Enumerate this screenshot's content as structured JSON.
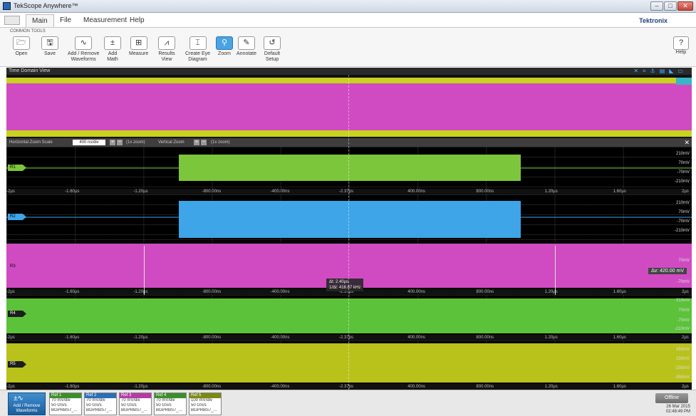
{
  "window": {
    "title": "TekScope Anywhere™"
  },
  "menu": {
    "tabs": [
      "Main",
      "File",
      "Measurement",
      "Help"
    ],
    "brand": "Tektronix"
  },
  "ribbon": {
    "group_label": "COMMON TOOLS",
    "tools": [
      {
        "label": "Open",
        "icon": "folder-icon",
        "glyph": "🗁"
      },
      {
        "label": "Save",
        "icon": "save-icon",
        "glyph": "🖫"
      },
      {
        "label": "Add / Remove\nWaveforms",
        "icon": "waveform-add-icon",
        "glyph": "∿"
      },
      {
        "label": "Add\nMath",
        "icon": "math-icon",
        "glyph": "±"
      },
      {
        "label": "Measure",
        "icon": "measure-icon",
        "glyph": "⊞"
      },
      {
        "label": "Results\nView",
        "icon": "results-icon",
        "glyph": "⩘"
      },
      {
        "label": "Create Eye\nDiagram",
        "icon": "eye-diagram-icon",
        "glyph": "⌶"
      },
      {
        "label": "Zoom",
        "icon": "zoom-icon",
        "glyph": "⚲"
      },
      {
        "label": "Annotate",
        "icon": "pen-icon",
        "glyph": "✎"
      },
      {
        "label": "Default\nSetup",
        "icon": "default-setup-icon",
        "glyph": "↺"
      }
    ],
    "help": "Help"
  },
  "view": {
    "title": "Time Domain View"
  },
  "zoom": {
    "horizontal_label": "Horizontal Zoom Scale",
    "horizontal_value": "400 ns/div",
    "horizontal_factor": "(1x zoom)",
    "vertical_label": "Vertical Zoom",
    "vertical_factor": "(1x zoom)"
  },
  "axis_labels_a": [
    "-2µs",
    "-1.60µs",
    "-1.20µs",
    "-800.00ns",
    "-400.00ns",
    "-2.37ps",
    "400.00ns",
    "800.00ns",
    "1.20µs",
    "1.60µs",
    "2µs"
  ],
  "axis_labels_b": [
    "-2µs",
    "-1.60µs",
    "-1.20µs",
    "-800.00ns",
    "-400.00ns",
    "-2.37ps",
    "400.00ns",
    "800.00ns",
    "1.20µs",
    "1.60µs",
    "2µs"
  ],
  "lanes": [
    {
      "label": "R1",
      "color": "#7cc63b",
      "scale": [
        "210mV",
        "70mV",
        "-70mV",
        "-210mV"
      ]
    },
    {
      "label": "R2",
      "color": "#3da5e8",
      "scale": [
        "210mV",
        "70mV",
        "-70mV",
        "-210mV"
      ]
    },
    {
      "label": "R3",
      "color": "#d04bc2",
      "scale": [
        "70mV",
        "-70mV"
      ]
    },
    {
      "label": "R4",
      "color": "#5bc23a",
      "scale": [
        "210mV",
        "70mV",
        "-70mV",
        "-210mV"
      ]
    },
    {
      "label": "R5",
      "color": "#b9c21b",
      "scale": [
        "350mV",
        "150mV",
        "-150mV",
        "-350mV"
      ]
    }
  ],
  "cursor": {
    "dt": "Δt: 2.40µs",
    "inv": "1/Δt: 416.67 kHz",
    "dv": "Δv: 420.00 mV"
  },
  "refs": [
    {
      "name": "Ref 1",
      "color": "#3b8f2a",
      "scale": "70 mV/div",
      "rate": "50 GS/s",
      "file": "BGPRBS7_..."
    },
    {
      "name": "Ref 2",
      "color": "#2a6fb8",
      "scale": "70 mV/div",
      "rate": "50 GS/s",
      "file": "BGPRBS7_..."
    },
    {
      "name": "Ref 3",
      "color": "#b53aa6",
      "scale": "70 mV/div",
      "rate": "50 GS/s",
      "file": "BGPRBS7_..."
    },
    {
      "name": "Ref 4",
      "color": "#3b8f2a",
      "scale": "70 mV/div",
      "rate": "50 GS/s",
      "file": "BGPRBS7_..."
    },
    {
      "name": "Ref 5",
      "color": "#7a8a12",
      "scale": "100 mV/div",
      "rate": "50 GS/s",
      "file": "BGPRBS7_..."
    }
  ],
  "bottom": {
    "add_label": "Add / Remove\nWaveforms",
    "status": "Offline",
    "date": "26 Mar 2015",
    "time": "02:48:49 PM"
  },
  "colors": {
    "magenta": "#d04bc2",
    "yellow": "#c8d21f",
    "green": "#6fc23a",
    "blue": "#3da5e8"
  }
}
